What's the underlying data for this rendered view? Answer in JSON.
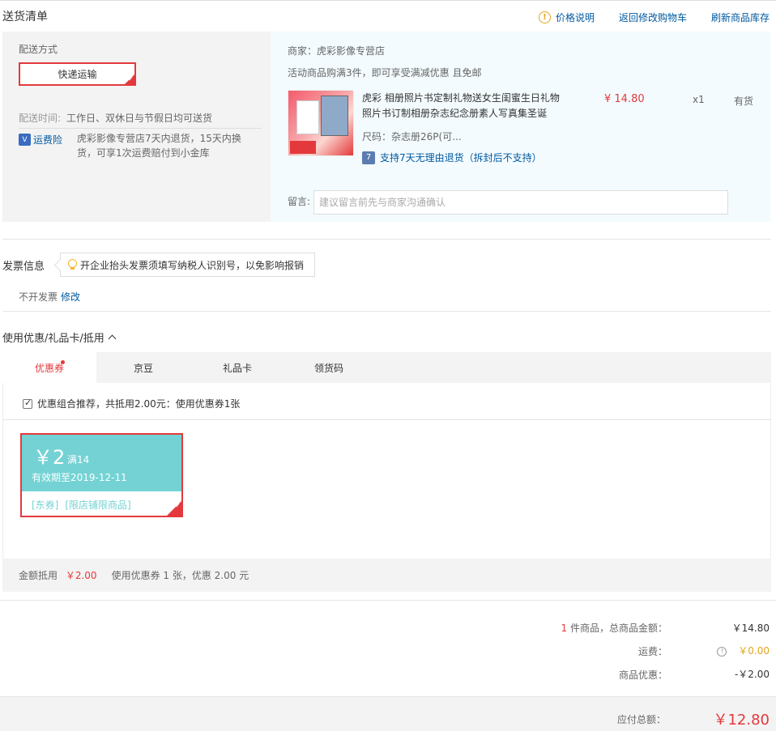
{
  "header": {
    "title": "送货清单",
    "links": [
      "价格说明",
      "返回修改购物车",
      "刷新商品库存"
    ]
  },
  "shipping": {
    "label": "配送方式",
    "method": "快递运输",
    "time_label": "配送时间:",
    "time_value": "工作日、双休日与节假日均可送货",
    "freight_badge": "运费险",
    "freight_desc": "虎彩影像专营店7天内退货，15天内换货，可享1次运费赔付到小金库"
  },
  "shop": {
    "name": "商家：虎彩影像专营店",
    "promo": "活动商品购满3件，即可享受满减优惠 且免邮"
  },
  "product": {
    "title": "虎彩 相册照片书定制礼物送女生闺蜜生日礼物照片书订制相册杂志纪念册素人写真集圣诞",
    "price": "¥ 14.80",
    "qty": "x1",
    "stock": "有货",
    "spec": "尺码：杂志册26P(可...",
    "return_policy": "支持7天无理由退货（拆封后不支持）",
    "return_icon": "7"
  },
  "remark": {
    "label": "留言:",
    "placeholder": "建议留言前先与商家沟通确认"
  },
  "invoice": {
    "title": "发票信息",
    "tip": "开企业抬头发票须填写纳税人识别号，以免影响报销",
    "status": "不开发票",
    "edit": "修改"
  },
  "coupons": {
    "title": "使用优惠/礼品卡/抵用",
    "tabs": [
      "优惠券",
      "京豆",
      "礼品卡",
      "领货码"
    ],
    "combo_text": "优惠组合推荐，共抵用2.00元：使用优惠券1张",
    "card": {
      "amount": "￥2",
      "condition": "满14",
      "expire": "有效期至2019-12-11",
      "tag1": "[东券]",
      "tag2": "[限店铺限商品]"
    },
    "discount_label": "金额抵用",
    "discount_amount": "￥2.00",
    "discount_detail": "使用优惠券 1 张，优惠 2.00 元"
  },
  "summary": {
    "count": "1",
    "goods_label": "件商品，总商品金额：",
    "goods_value": "￥14.80",
    "freight_label": "运费：",
    "freight_value": "￥0.00",
    "discount_label": "商品优惠：",
    "discount_value": "-￥2.00",
    "total_label": "应付总额：",
    "total_value": "￥12.80"
  },
  "colors": {
    "accent": "#e4393c",
    "link": "#005aa0",
    "coupon": "#74d2d4"
  }
}
